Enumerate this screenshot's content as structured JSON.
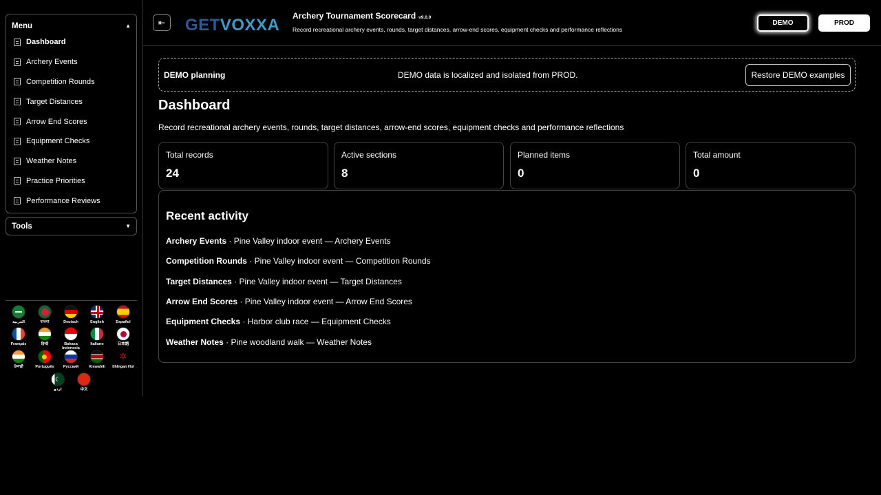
{
  "sidebar": {
    "menu_title": "Menu",
    "menu_items": [
      {
        "label": "Dashboard"
      },
      {
        "label": "Archery Events"
      },
      {
        "label": "Competition Rounds"
      },
      {
        "label": "Target Distances"
      },
      {
        "label": "Arrow End Scores"
      },
      {
        "label": "Equipment Checks"
      },
      {
        "label": "Weather Notes"
      },
      {
        "label": "Practice Priorities"
      },
      {
        "label": "Performance Reviews"
      }
    ],
    "tools_title": "Tools",
    "languages": [
      {
        "name": "العربية"
      },
      {
        "name": "বাংলা"
      },
      {
        "name": "Deutsch"
      },
      {
        "name": "English"
      },
      {
        "name": "Español"
      },
      {
        "name": "Français"
      },
      {
        "name": "हिन्दी"
      },
      {
        "name": "Bahasa Indonesia"
      },
      {
        "name": "Italiano"
      },
      {
        "name": "日本語"
      },
      {
        "name": "ਪੰਜਾਬੀ"
      },
      {
        "name": "Português"
      },
      {
        "name": "Русский"
      },
      {
        "name": "Kiswahili"
      },
      {
        "name": "tlhIngan Hol"
      },
      {
        "name": "اردو"
      },
      {
        "name": "中文"
      }
    ]
  },
  "header": {
    "logo_get": "GET",
    "logo_v": "V",
    "logo_rest": "OXXA",
    "title": "Archery Tournament Scorecard",
    "version": "v9.0.0",
    "subtitle": "Record recreational archery events, rounds, target distances, arrow-end scores, equipment checks and performance reflections",
    "demo_label": "DEMO",
    "prod_label": "PROD"
  },
  "banner": {
    "label": "DEMO planning",
    "message": "DEMO data is localized and isolated from PROD.",
    "restore_label": "Restore DEMO examples"
  },
  "main": {
    "title": "Dashboard",
    "subtitle": "Record recreational archery events, rounds, target distances, arrow-end scores, equipment checks and performance reflections",
    "cards": [
      {
        "label": "Total records",
        "value": "24"
      },
      {
        "label": "Active sections",
        "value": "8"
      },
      {
        "label": "Planned items",
        "value": "0"
      },
      {
        "label": "Total amount",
        "value": "0"
      }
    ],
    "activity_title": "Recent activity",
    "activity": [
      {
        "section": "Archery Events",
        "text": " · Pine Valley indoor event — Archery Events"
      },
      {
        "section": "Competition Rounds",
        "text": " · Pine Valley indoor event — Competition Rounds"
      },
      {
        "section": "Target Distances",
        "text": " · Pine Valley indoor event — Target Distances"
      },
      {
        "section": "Arrow End Scores",
        "text": " · Pine Valley indoor event — Arrow End Scores"
      },
      {
        "section": "Equipment Checks",
        "text": " · Harbor club race — Equipment Checks"
      },
      {
        "section": "Weather Notes",
        "text": " · Pine woodland walk — Weather Notes"
      }
    ]
  }
}
